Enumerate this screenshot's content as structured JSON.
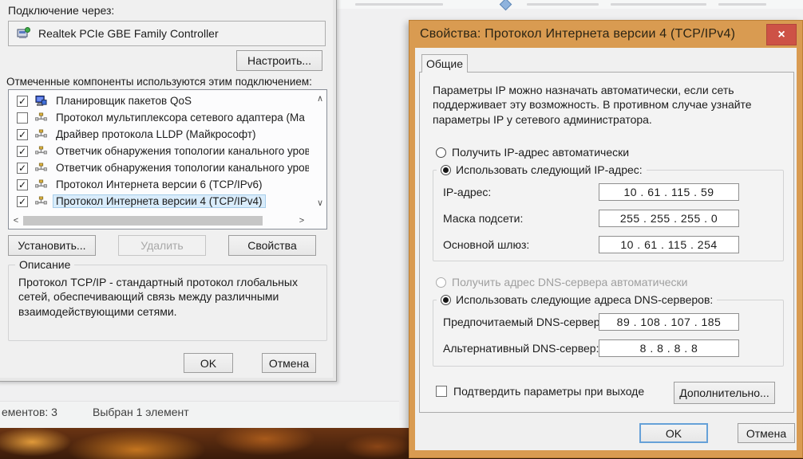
{
  "glyphs": {
    "check": "✓",
    "close": "×",
    "scroll_up": "∧",
    "scroll_down": "∨",
    "scroll_left": "<",
    "scroll_right": ">"
  },
  "colors": {
    "accent_orange": "#d99b51",
    "close_red": "#cd5246",
    "dialog_bg": "#f0f0f0",
    "selection_blue": "#d9ecfb"
  },
  "explorer": {
    "status_items_count": "ементов: 3",
    "status_selected": "Выбран 1 элемент"
  },
  "adapter_dialog": {
    "connect_via_label": "Подключение через:",
    "adapter_name": "Realtek PCIe GBE Family Controller",
    "configure_button": "Настроить...",
    "components_label": "Отмеченные компоненты используются этим подключением:",
    "components": [
      {
        "label": "Планировщик пакетов QoS",
        "checked": true,
        "selected": false,
        "icon": "qos-scheduler-icon"
      },
      {
        "label": "Протокол мультиплексора сетевого адаптера (Ма",
        "checked": false,
        "selected": false,
        "icon": "protocol-icon"
      },
      {
        "label": "Драйвер протокола LLDP (Майкрософт)",
        "checked": true,
        "selected": false,
        "icon": "protocol-icon"
      },
      {
        "label": "Ответчик обнаружения топологии канального уров",
        "checked": true,
        "selected": false,
        "icon": "protocol-icon"
      },
      {
        "label": "Ответчик обнаружения топологии канального уров",
        "checked": true,
        "selected": false,
        "icon": "protocol-icon"
      },
      {
        "label": "Протокол Интернета версии 6 (TCP/IPv6)",
        "checked": true,
        "selected": false,
        "icon": "protocol-icon"
      },
      {
        "label": "Протокол Интернета версии 4 (TCP/IPv4)",
        "checked": true,
        "selected": true,
        "icon": "protocol-icon"
      }
    ],
    "install_button": "Установить...",
    "uninstall_button": "Удалить",
    "properties_button": "Свойства",
    "description_group_label": "Описание",
    "description_text": "Протокол TCP/IP - стандартный протокол глобальных сетей, обеспечивающий связь между различными взаимодействующими сетями.",
    "ok_button": "OK",
    "cancel_button": "Отмена"
  },
  "tcpip_dialog": {
    "title": "Свойства: Протокол Интернета версии 4 (TCP/IPv4)",
    "general_tab": "Общие",
    "intro_text": "Параметры IP можно назначать автоматически, если сеть поддерживает эту возможность. В противном случае узнайте параметры IP у сетевого администратора.",
    "obtain_ip_auto_radio": {
      "label": "Получить IP-адрес автоматически",
      "checked": false,
      "disabled": false
    },
    "use_ip_radio": {
      "label": "Использовать следующий IP-адрес:",
      "checked": true,
      "disabled": false
    },
    "ip_fields": [
      {
        "label": "IP-адрес:",
        "value": "10 . 61 . 115 . 59"
      },
      {
        "label": "Маска подсети:",
        "value": "255 . 255 . 255 . 0"
      },
      {
        "label": "Основной шлюз:",
        "value": "10 . 61 . 115 . 254"
      }
    ],
    "obtain_dns_auto_radio": {
      "label": "Получить адрес DNS-сервера автоматически",
      "checked": false,
      "disabled": true
    },
    "use_dns_radio": {
      "label": "Использовать следующие адреса DNS-серверов:",
      "checked": true,
      "disabled": false
    },
    "dns_fields": [
      {
        "label": "Предпочитаемый DNS-сервер:",
        "value": "89 . 108 . 107 . 185"
      },
      {
        "label": "Альтернативный DNS-сервер:",
        "value": "8 . 8 . 8 . 8"
      }
    ],
    "validate_checkbox": {
      "label": "Подтвердить параметры при выходе",
      "checked": false
    },
    "advanced_button": "Дополнительно...",
    "ok_button": "OK",
    "cancel_button": "Отмена"
  }
}
